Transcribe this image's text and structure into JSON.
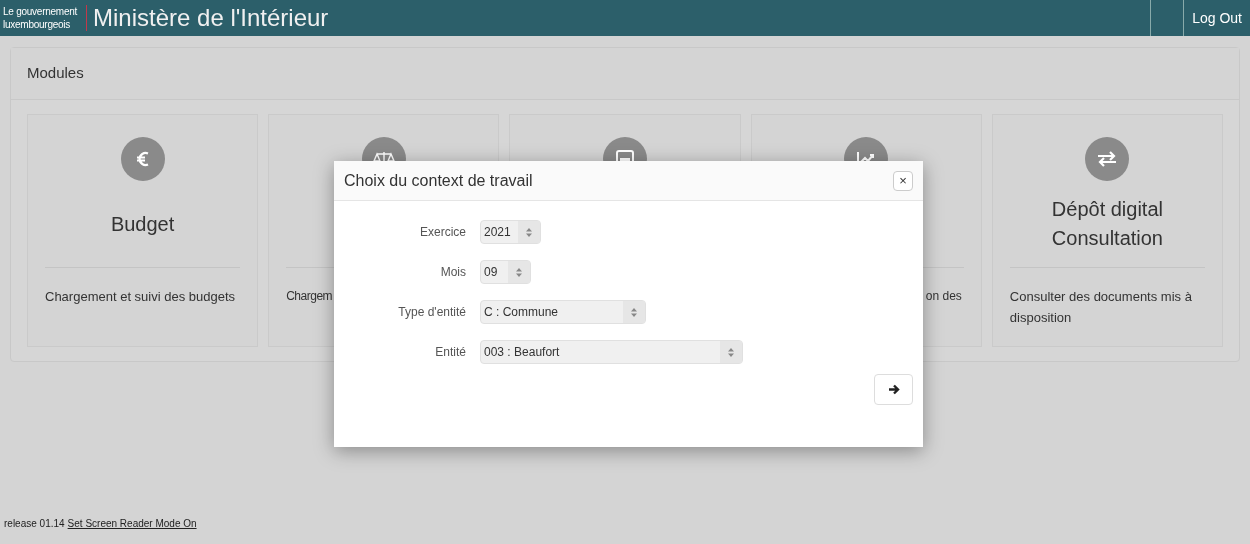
{
  "header": {
    "org_lines": [
      "Le gouvernement",
      "luxembourgeois"
    ],
    "title": "Ministère de l'Intérieur",
    "logout": "Log Out"
  },
  "modules": {
    "title": "Modules",
    "cards": [
      {
        "kind": "module",
        "title_lines": [
          "Budget"
        ],
        "description": "Chargement et suivi des budgets"
      },
      {
        "kind": "module",
        "description": "Chargem"
      },
      {
        "kind": "module"
      },
      {
        "kind": "module",
        "description": "on des"
      },
      {
        "kind": "module",
        "title_lines": [
          "Dépôt digital",
          "Consultation"
        ],
        "description": "Consulter des documents mis à disposition"
      }
    ]
  },
  "dialog": {
    "title": "Choix du context de travail",
    "close": "×",
    "fields": [
      {
        "label": "Exercice",
        "value": "2021"
      },
      {
        "label": "Mois",
        "value": "09"
      },
      {
        "label": "Type d'entité",
        "value": "C : Commune"
      },
      {
        "label": "Entité",
        "value": "003 : Beaufort"
      }
    ]
  },
  "footer": {
    "release": "release 01.14",
    "link": "Set Screen Reader Mode On"
  }
}
